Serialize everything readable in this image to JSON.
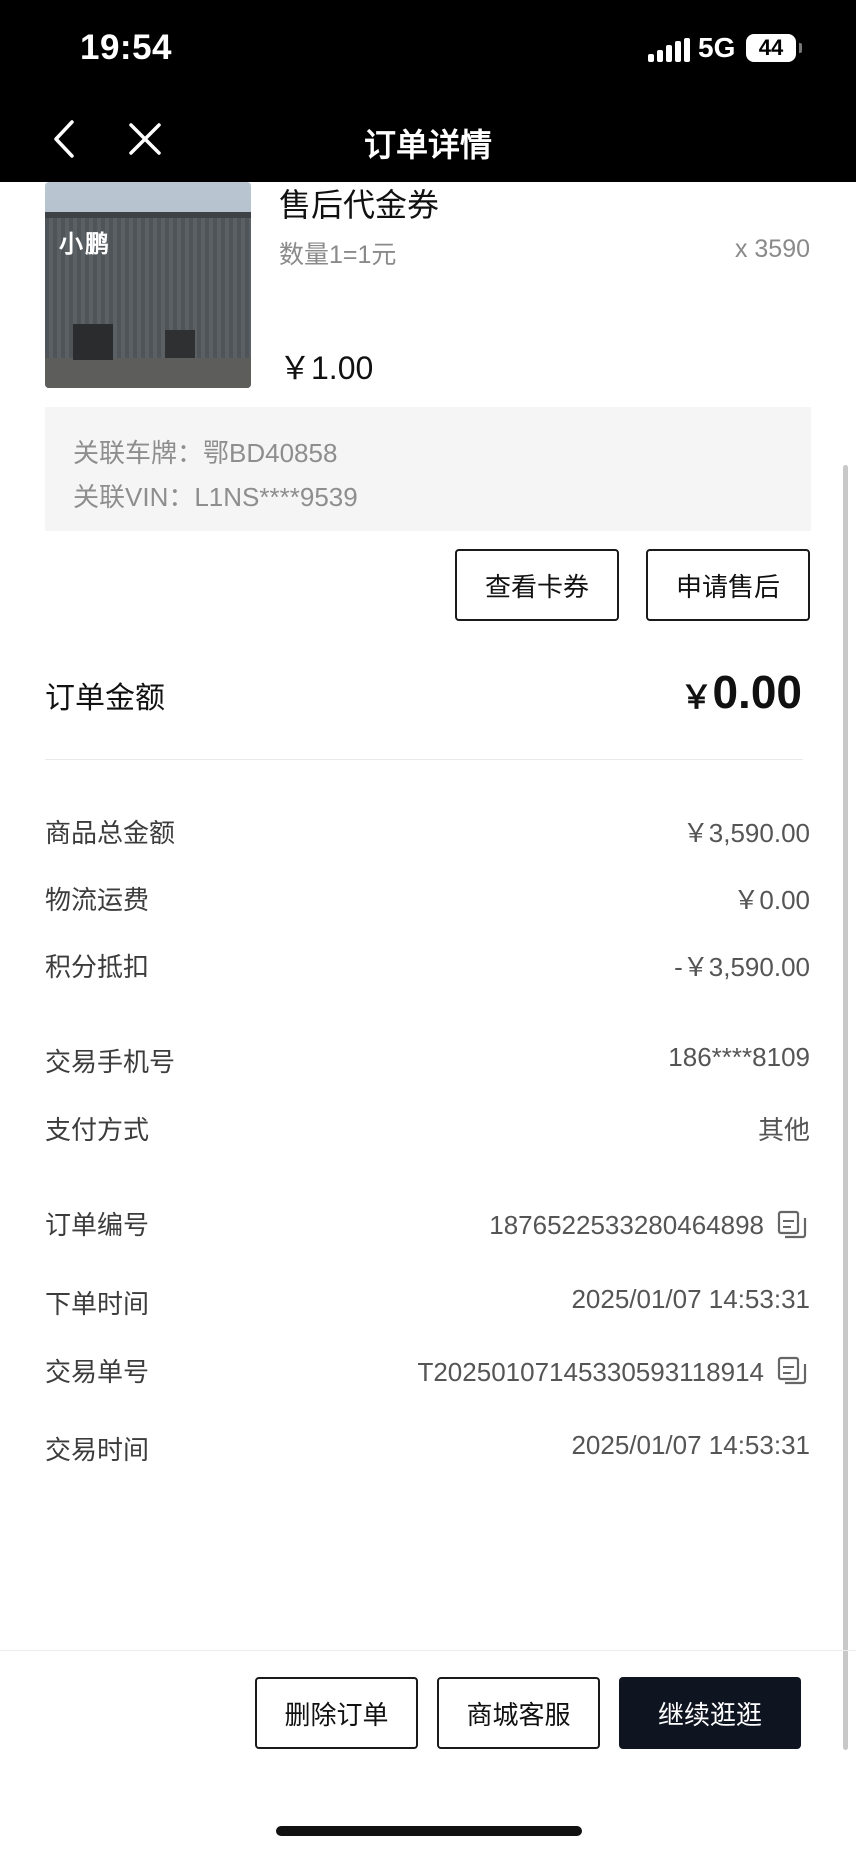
{
  "status_bar": {
    "time": "19:54",
    "network": "5G",
    "battery": "44"
  },
  "nav": {
    "title": "订单详情",
    "back_icon": "chevron-left-icon",
    "close_icon": "close-icon"
  },
  "product": {
    "name": "售后代金券",
    "quantity_text": "数量1=1元",
    "count": "x 3590",
    "price": "￥1.00",
    "thumbnail_logo": "小鹏"
  },
  "vehicle": {
    "plate": "关联车牌：鄂BD40858",
    "vin": "关联VIN：L1NS****9539"
  },
  "item_actions": {
    "view_coupon": "查看卡券",
    "apply_after_sales": "申请售后"
  },
  "order_total": {
    "label": "订单金额",
    "currency": "￥",
    "amount": "0.00"
  },
  "amounts": [
    {
      "label": "商品总金额",
      "value": "￥3,590.00"
    },
    {
      "label": "物流运费",
      "value": "￥0.00"
    },
    {
      "label": "积分抵扣",
      "value": "-￥3,590.00"
    }
  ],
  "payment": [
    {
      "label": "交易手机号",
      "value": "186****8109"
    },
    {
      "label": "支付方式",
      "value": "其他"
    }
  ],
  "order_info": [
    {
      "label": "订单编号",
      "value": "1876522533280464898",
      "copyable": true
    },
    {
      "label": "下单时间",
      "value": "2025/01/07 14:53:31",
      "copyable": false
    },
    {
      "label": "交易单号",
      "value": "T202501071453305931189​14",
      "copyable": true
    },
    {
      "label": "交易时间",
      "value": "2025/01/07 14:53:31",
      "copyable": false
    }
  ],
  "footer": {
    "delete_order": "删除订单",
    "customer_service": "商城客服",
    "continue_shopping": "继续逛逛"
  },
  "colors": {
    "primary_button": "#0f1520",
    "header_bg": "#000000",
    "muted_text": "#8a8a8a"
  }
}
